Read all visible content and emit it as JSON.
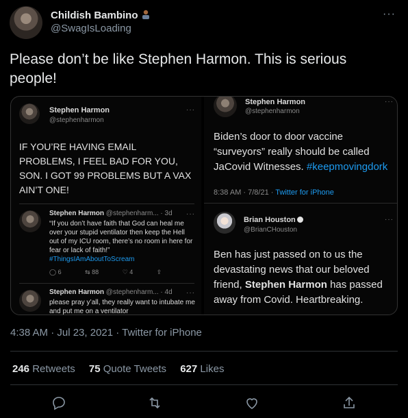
{
  "author": {
    "name": "Childish Bambino",
    "handle": "@SwagIsLoading"
  },
  "tweet": {
    "text": "Please don’t be like Stephen Harmon. This is serious people!",
    "more": "···"
  },
  "media": {
    "left": {
      "post": {
        "name": "Stephen Harmon",
        "handle": "@stephenharmon",
        "more": "···",
        "text": "IF YOU’RE HAVING EMAIL PROBLEMS, I FEEL BAD FOR YOU, SON. I GOT 99 PROBLEMS BUT A VAX AIN’T ONE!"
      },
      "reply1": {
        "name": "Stephen Harmon",
        "handle_time": "@stephenharm... · 3d",
        "more": "···",
        "text": "“If you don’t have faith that God can heal me over your stupid ventilator then keep the Hell out of my ICU room, there’s no room in here for fear or lack of faith!”",
        "hashtag": "#ThingsIAmAboutToScream",
        "replies": "6",
        "retweets": "88",
        "likes": "4"
      },
      "reply2": {
        "name": "Stephen Harmon",
        "handle_time": "@stephenharm... · 4d",
        "more": "···",
        "text": "please pray y’all, they really want to intubate me and put me on a ventilator"
      }
    },
    "right": {
      "post1": {
        "name": "Stephen Harmon",
        "handle": "@stephenharmon",
        "more": "···",
        "text": "Biden’s door to door vaccine “surveyors” really should be called JaCovid Witnesses.",
        "hashtag": "#keepmovingdork",
        "meta_time": "8:38 AM · 7/8/21 ·",
        "meta_source": "Twitter for iPhone"
      },
      "post2": {
        "name": "Brian Houston",
        "handle": "@BrianCHouston",
        "more": "···",
        "text_pre": "Ben has just passed on to us the devastating news that our beloved friend,",
        "text_bold": "Stephen Harmon",
        "text_post": "has passed away from Covid. Heartbreaking."
      }
    }
  },
  "meta": {
    "timestamp": "4:38 AM · Jul 23, 2021 · Twitter for iPhone"
  },
  "stats": {
    "retweets_count": "246",
    "retweets_label": "Retweets",
    "quotes_count": "75",
    "quotes_label": "Quote Tweets",
    "likes_count": "627",
    "likes_label": "Likes"
  },
  "icons": {
    "reply": "reply-icon",
    "retweet": "retweet-icon",
    "like": "heart-icon",
    "share": "share-icon"
  },
  "colors": {
    "background": "#000000",
    "text": "#e7e9ea",
    "secondary": "#8b98a5",
    "link": "#1d9bf0"
  }
}
